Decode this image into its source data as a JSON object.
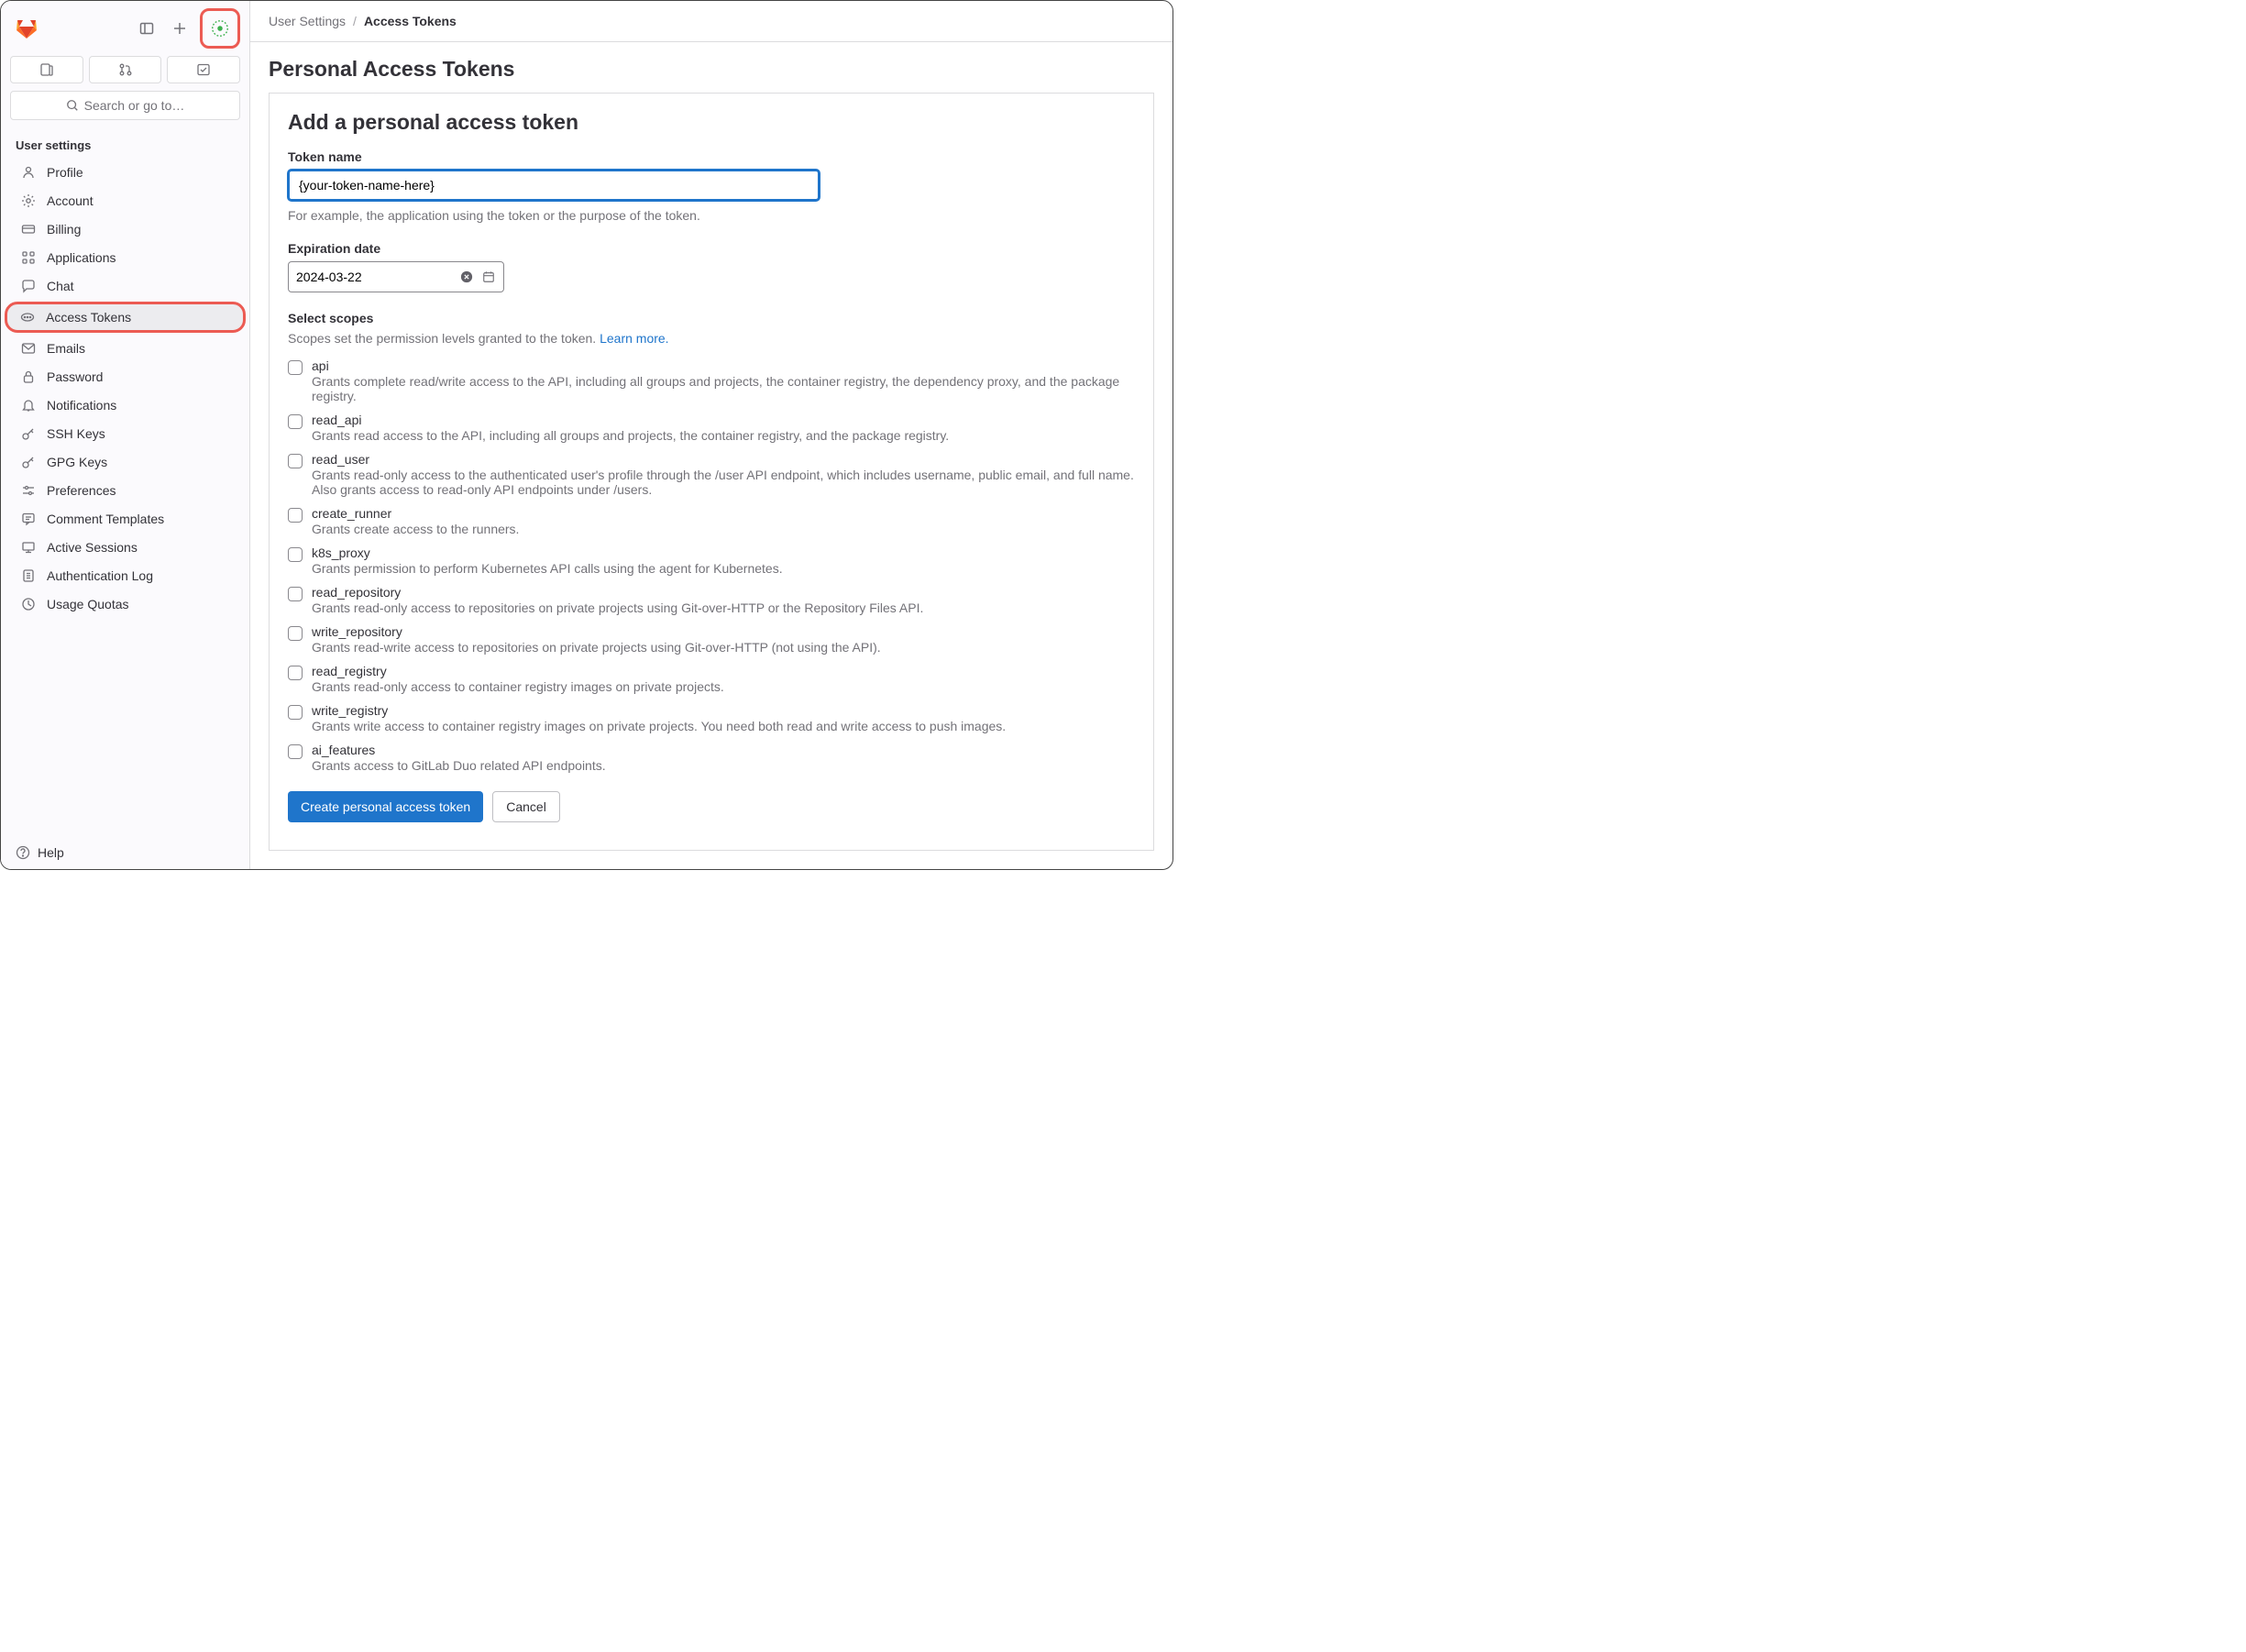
{
  "sidebar": {
    "search_placeholder": "Search or go to…",
    "section_title": "User settings",
    "items": [
      {
        "label": "Profile",
        "icon": "profile-icon"
      },
      {
        "label": "Account",
        "icon": "account-icon"
      },
      {
        "label": "Billing",
        "icon": "billing-icon"
      },
      {
        "label": "Applications",
        "icon": "applications-icon"
      },
      {
        "label": "Chat",
        "icon": "chat-icon"
      },
      {
        "label": "Access Tokens",
        "icon": "token-icon"
      },
      {
        "label": "Emails",
        "icon": "emails-icon"
      },
      {
        "label": "Password",
        "icon": "password-icon"
      },
      {
        "label": "Notifications",
        "icon": "notifications-icon"
      },
      {
        "label": "SSH Keys",
        "icon": "key-icon"
      },
      {
        "label": "GPG Keys",
        "icon": "key-icon"
      },
      {
        "label": "Preferences",
        "icon": "preferences-icon"
      },
      {
        "label": "Comment Templates",
        "icon": "comment-icon"
      },
      {
        "label": "Active Sessions",
        "icon": "sessions-icon"
      },
      {
        "label": "Authentication Log",
        "icon": "log-icon"
      },
      {
        "label": "Usage Quotas",
        "icon": "quota-icon"
      }
    ],
    "help_label": "Help"
  },
  "breadcrumb": {
    "parent": "User Settings",
    "current": "Access Tokens"
  },
  "page": {
    "title": "Personal Access Tokens",
    "form_heading": "Add a personal access token",
    "token_name_label": "Token name",
    "token_name_value": "{your-token-name-here}",
    "token_name_help": "For example, the application using the token or the purpose of the token.",
    "expiration_label": "Expiration date",
    "expiration_value": "2024-03-22",
    "scopes_heading": "Select scopes",
    "scopes_desc_prefix": "Scopes set the permission levels granted to the token. ",
    "scopes_learn_more": "Learn more.",
    "scopes": [
      {
        "name": "api",
        "desc": "Grants complete read/write access to the API, including all groups and projects, the container registry, the dependency proxy, and the package registry."
      },
      {
        "name": "read_api",
        "desc": "Grants read access to the API, including all groups and projects, the container registry, and the package registry."
      },
      {
        "name": "read_user",
        "desc": "Grants read-only access to the authenticated user's profile through the /user API endpoint, which includes username, public email, and full name. Also grants access to read-only API endpoints under /users."
      },
      {
        "name": "create_runner",
        "desc": "Grants create access to the runners."
      },
      {
        "name": "k8s_proxy",
        "desc": "Grants permission to perform Kubernetes API calls using the agent for Kubernetes."
      },
      {
        "name": "read_repository",
        "desc": "Grants read-only access to repositories on private projects using Git-over-HTTP or the Repository Files API."
      },
      {
        "name": "write_repository",
        "desc": "Grants read-write access to repositories on private projects using Git-over-HTTP (not using the API)."
      },
      {
        "name": "read_registry",
        "desc": "Grants read-only access to container registry images on private projects."
      },
      {
        "name": "write_registry",
        "desc": "Grants write access to container registry images on private projects. You need both read and write access to push images."
      },
      {
        "name": "ai_features",
        "desc": "Grants access to GitLab Duo related API endpoints."
      }
    ],
    "create_button": "Create personal access token",
    "cancel_button": "Cancel"
  }
}
